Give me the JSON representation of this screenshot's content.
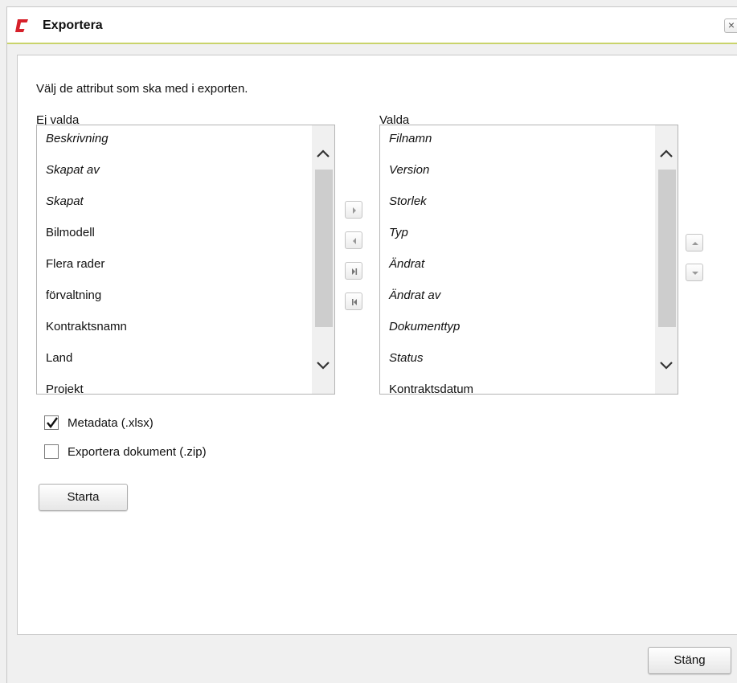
{
  "dialog": {
    "title": "Exportera",
    "close_glyph": "×",
    "accent_color": "#c9d36b",
    "logo_color": "#d6202a",
    "icons": {
      "logo": "app-logo-icon",
      "close": "close-icon"
    }
  },
  "instruction": "Välj de attribut som ska med i exporten.",
  "available": {
    "label": "Ej valda",
    "items": [
      {
        "label": "Beskrivning",
        "italic": true
      },
      {
        "label": "Skapat av",
        "italic": true
      },
      {
        "label": "Skapat",
        "italic": true
      },
      {
        "label": "Bilmodell",
        "italic": false
      },
      {
        "label": "Flera rader",
        "italic": false
      },
      {
        "label": "förvaltning",
        "italic": false
      },
      {
        "label": "Kontraktsnamn",
        "italic": false
      },
      {
        "label": "Land",
        "italic": false
      },
      {
        "label": "Projekt",
        "italic": false
      }
    ]
  },
  "selected": {
    "label": "Valda",
    "items": [
      {
        "label": "Filnamn",
        "italic": true
      },
      {
        "label": "Version",
        "italic": true
      },
      {
        "label": "Storlek",
        "italic": true
      },
      {
        "label": "Typ",
        "italic": true
      },
      {
        "label": "Ändrat",
        "italic": true
      },
      {
        "label": "Ändrat av",
        "italic": true
      },
      {
        "label": "Dokumenttyp",
        "italic": true
      },
      {
        "label": "Status",
        "italic": true
      },
      {
        "label": "Kontraktsdatum",
        "italic": false
      }
    ]
  },
  "move_buttons": {
    "add": "move-right-icon",
    "remove": "move-left-icon",
    "add_all": "move-all-right-icon",
    "remove_all": "move-all-left-icon",
    "up": "move-up-icon",
    "down": "move-down-icon"
  },
  "options": {
    "metadata": {
      "label": "Metadata (.xlsx)",
      "checked": true
    },
    "documents": {
      "label": "Exportera dokument (.zip)",
      "checked": false
    }
  },
  "buttons": {
    "start": "Starta",
    "close": "Stäng"
  }
}
